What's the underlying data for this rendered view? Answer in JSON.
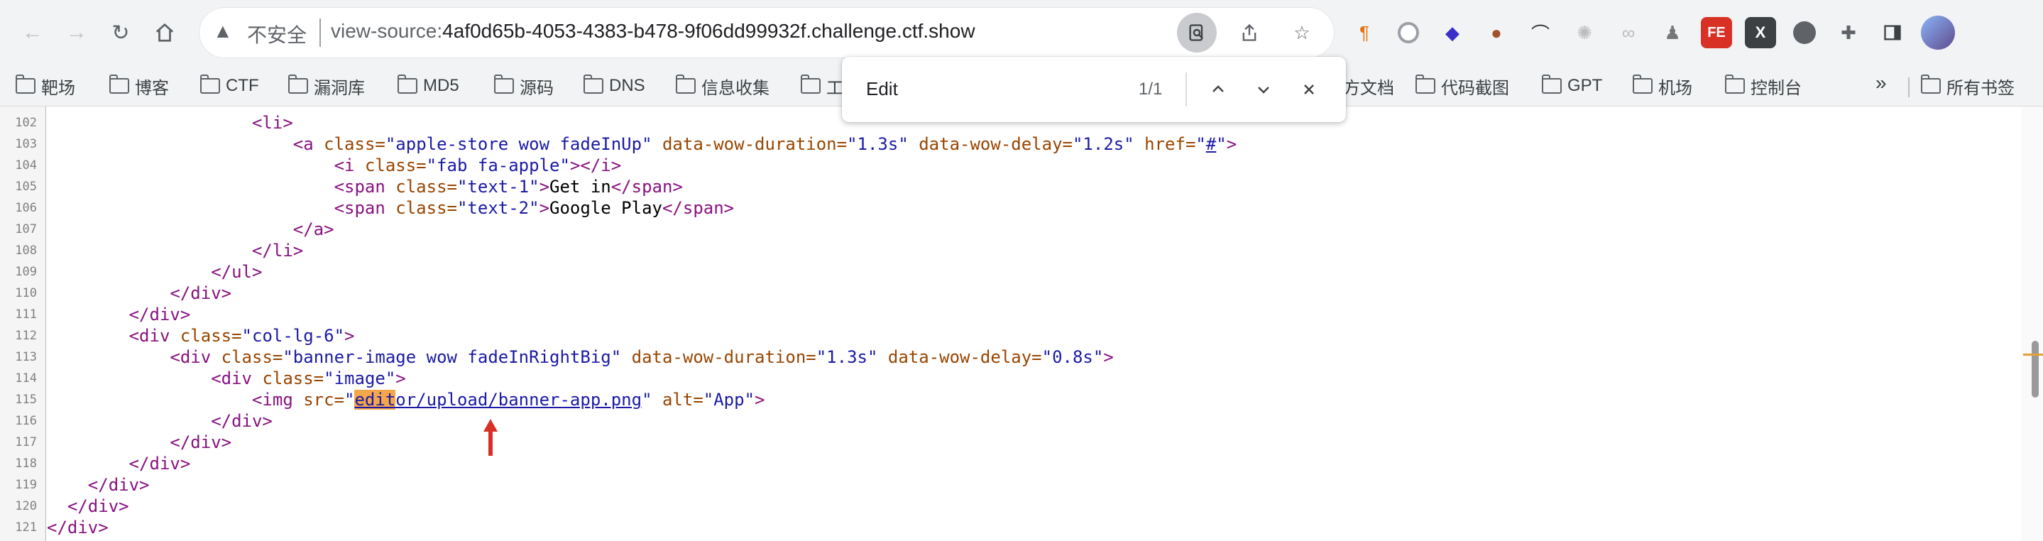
{
  "browser": {
    "address": {
      "insecure_label": "不安全",
      "url_prefix": "view-source:",
      "url_host": "4af0d65b-4053-4383-b478-9f06dd99932f.challenge.ctf.show"
    },
    "extensions": [
      "pilcrow",
      "circle",
      "layers",
      "cookie",
      "hat",
      "sparkle",
      "links",
      "spy",
      "FE",
      "X",
      "dark-circle",
      "puzzle",
      "sidebar"
    ]
  },
  "bookmarks": {
    "items": [
      {
        "label": "靶场"
      },
      {
        "label": "博客"
      },
      {
        "label": "CTF"
      },
      {
        "label": "漏洞库"
      },
      {
        "label": "MD5"
      },
      {
        "label": "源码"
      },
      {
        "label": "DNS"
      },
      {
        "label": "信息收集"
      },
      {
        "label": "工"
      },
      {
        "label": "方文档"
      },
      {
        "label": "代码截图"
      },
      {
        "label": "GPT"
      },
      {
        "label": "机场"
      },
      {
        "label": "控制台"
      }
    ],
    "more": "»",
    "all": "所有书签"
  },
  "find": {
    "query": "Edit",
    "count": "1/1"
  },
  "source": {
    "line_numbers": [
      "102",
      "103",
      "104",
      "105",
      "106",
      "107",
      "108",
      "109",
      "110",
      "111",
      "112",
      "113",
      "114",
      "115",
      "116",
      "117",
      "118",
      "119",
      "120",
      "121"
    ],
    "l102": {
      "t1": "<li>"
    },
    "l103": {
      "t1": "<a",
      "a1": "class=",
      "v1": "\"apple-store wow fadeInUp\"",
      "a2": "data-wow-duration=",
      "v2": "\"1.3s\"",
      "a3": "data-wow-delay=",
      "v3": "\"1.2s\"",
      "a4": "href=",
      "v4q1": "\"",
      "v4": "#",
      "v4q2": "\"",
      "t2": ">"
    },
    "l104": {
      "t1": "<i",
      "a1": "class=",
      "v1": "\"fab fa-apple\"",
      "t2": "></i>"
    },
    "l105": {
      "t1": "<span",
      "a1": "class=",
      "v1": "\"text-1\"",
      "t2": ">",
      "text": "Get in",
      "t3": "</span>"
    },
    "l106": {
      "t1": "<span",
      "a1": "class=",
      "v1": "\"text-2\"",
      "t2": ">",
      "text": "Google Play",
      "t3": "</span>"
    },
    "l107": {
      "t1": "</a>"
    },
    "l108": {
      "t1": "</li>"
    },
    "l109": {
      "t1": "</ul>"
    },
    "l110": {
      "t1": "</div>"
    },
    "l111": {
      "t1": "</div>"
    },
    "l112": {
      "t1": "<div",
      "a1": "class=",
      "v1": "\"col-lg-6\"",
      "t2": ">"
    },
    "l113": {
      "t1": "<div",
      "a1": "class=",
      "v1": "\"banner-image wow fadeInRightBig\"",
      "a2": "data-wow-duration=",
      "v2": "\"1.3s\"",
      "a3": "data-wow-delay=",
      "v3": "\"0.8s\"",
      "t2": ">"
    },
    "l114": {
      "t1": "<div",
      "a1": "class=",
      "v1": "\"image\"",
      "t2": ">"
    },
    "l115": {
      "t1": "<img",
      "a1": "src=",
      "q1": "\"",
      "hl": "edit",
      "link": "or/upload/banner-app.png",
      "q2": "\"",
      "a2": "alt=",
      "v2": "\"App\"",
      "t2": ">"
    },
    "l116": {
      "t1": "</div>"
    },
    "l117": {
      "t1": "</div>"
    },
    "l118": {
      "t1": "</div>"
    },
    "l119": {
      "t1": "</div>"
    },
    "l120": {
      "t1": "</div>"
    },
    "l121": {
      "t1": "</div>"
    }
  },
  "colors": {
    "tag": "#881280",
    "attribute": "#994500",
    "value": "#1a1aa6",
    "highlight": "#f4a64a",
    "annotation_arrow": "#d93025"
  }
}
